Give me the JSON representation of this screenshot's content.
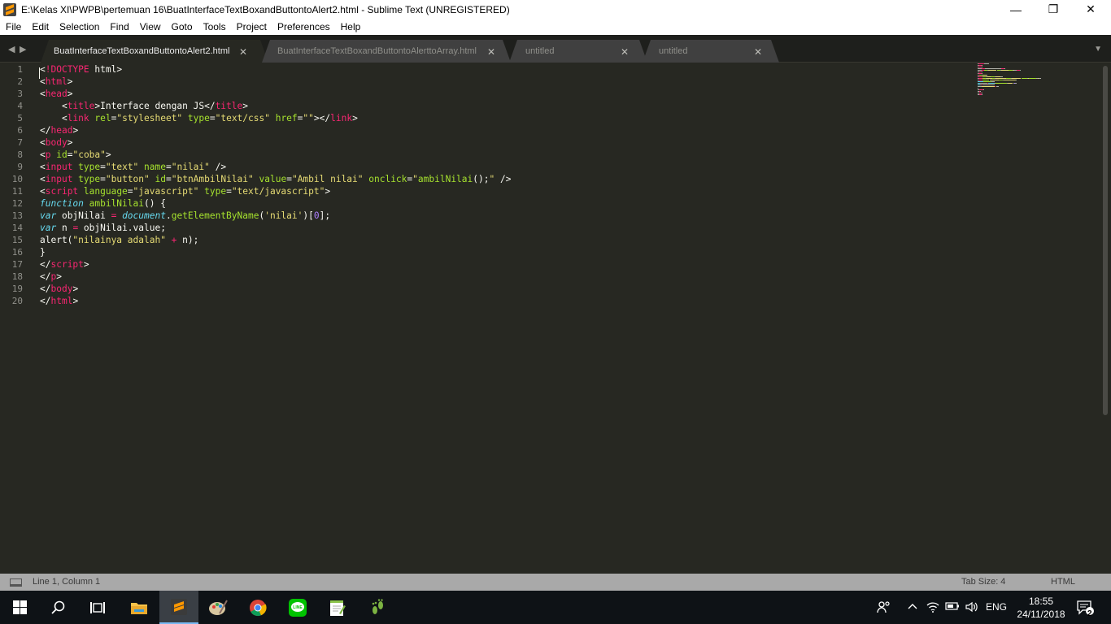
{
  "window": {
    "title": "E:\\Kelas XI\\PWPB\\pertemuan 16\\BuatInterfaceTextBoxandButtontoAlert2.html - Sublime Text (UNREGISTERED)",
    "controls": {
      "minimize": "—",
      "maximize": "❐",
      "close": "✕"
    }
  },
  "menu": [
    "File",
    "Edit",
    "Selection",
    "Find",
    "View",
    "Goto",
    "Tools",
    "Project",
    "Preferences",
    "Help"
  ],
  "tabs": [
    {
      "label": "BuatInterfaceTextBoxandButtontoAlert2.html",
      "active": true,
      "close": "✕"
    },
    {
      "label": "BuatInterfaceTextBoxandButtontoAlerttoArray.html",
      "active": false,
      "close": "✕"
    },
    {
      "label": "untitled",
      "active": false,
      "close": "✕"
    },
    {
      "label": "untitled",
      "active": false,
      "close": "✕"
    }
  ],
  "editor": {
    "line_numbers": [
      "1",
      "2",
      "3",
      "4",
      "5",
      "6",
      "7",
      "8",
      "9",
      "10",
      "11",
      "12",
      "13",
      "14",
      "15",
      "16",
      "17",
      "18",
      "19",
      "20"
    ],
    "code": [
      [
        [
          "p",
          "<"
        ],
        [
          "t",
          "!DOCTYPE"
        ],
        [
          "p",
          " html>"
        ]
      ],
      [
        [
          "p",
          "<"
        ],
        [
          "t",
          "html"
        ],
        [
          "p",
          ">"
        ]
      ],
      [
        [
          "p",
          "<"
        ],
        [
          "t",
          "head"
        ],
        [
          "p",
          ">"
        ]
      ],
      [
        [
          "p",
          "    <"
        ],
        [
          "t",
          "title"
        ],
        [
          "p",
          ">Interface dengan JS</"
        ],
        [
          "t",
          "title"
        ],
        [
          "p",
          ">"
        ]
      ],
      [
        [
          "p",
          "    <"
        ],
        [
          "t",
          "link"
        ],
        [
          "a",
          " rel"
        ],
        [
          "p",
          "="
        ],
        [
          "s",
          "\"stylesheet\""
        ],
        [
          "a",
          " type"
        ],
        [
          "p",
          "="
        ],
        [
          "s",
          "\"text/css\""
        ],
        [
          "a",
          " href"
        ],
        [
          "p",
          "="
        ],
        [
          "s",
          "\"\""
        ],
        [
          "p",
          "></"
        ],
        [
          "t",
          "link"
        ],
        [
          "p",
          ">"
        ]
      ],
      [
        [
          "p",
          "</"
        ],
        [
          "t",
          "head"
        ],
        [
          "p",
          ">"
        ]
      ],
      [
        [
          "p",
          "<"
        ],
        [
          "t",
          "body"
        ],
        [
          "p",
          ">"
        ]
      ],
      [
        [
          "p",
          "<"
        ],
        [
          "t",
          "p"
        ],
        [
          "a",
          " id"
        ],
        [
          "p",
          "="
        ],
        [
          "s",
          "\"coba\""
        ],
        [
          "p",
          ">"
        ]
      ],
      [
        [
          "p",
          "<"
        ],
        [
          "t",
          "input"
        ],
        [
          "a",
          " type"
        ],
        [
          "p",
          "="
        ],
        [
          "s",
          "\"text\""
        ],
        [
          "a",
          " name"
        ],
        [
          "p",
          "="
        ],
        [
          "s",
          "\"nilai\""
        ],
        [
          "p",
          " />"
        ]
      ],
      [
        [
          "p",
          "<"
        ],
        [
          "t",
          "input"
        ],
        [
          "a",
          " type"
        ],
        [
          "p",
          "="
        ],
        [
          "s",
          "\"button\""
        ],
        [
          "a",
          " id"
        ],
        [
          "p",
          "="
        ],
        [
          "s",
          "\"btnAmbilNilai\""
        ],
        [
          "a",
          " value"
        ],
        [
          "p",
          "="
        ],
        [
          "s",
          "\"Ambil nilai\""
        ],
        [
          "a",
          " onclick"
        ],
        [
          "p",
          "="
        ],
        [
          "s",
          "\""
        ],
        [
          "f",
          "ambilNilai"
        ],
        [
          "p",
          "();"
        ],
        [
          "s",
          "\""
        ],
        [
          "p",
          " />"
        ]
      ],
      [
        [
          "p",
          "<"
        ],
        [
          "t",
          "script"
        ],
        [
          "a",
          " language"
        ],
        [
          "p",
          "="
        ],
        [
          "s",
          "\"javascript\""
        ],
        [
          "a",
          " type"
        ],
        [
          "p",
          "="
        ],
        [
          "s",
          "\"text/javascript\""
        ],
        [
          "p",
          ">"
        ]
      ],
      [
        [
          "k",
          "function"
        ],
        [
          "f",
          " ambilNilai"
        ],
        [
          "p",
          "() {"
        ]
      ],
      [
        [
          "k",
          "var"
        ],
        [
          "p",
          " objNilai "
        ],
        [
          "o",
          "="
        ],
        [
          "k",
          " document"
        ],
        [
          "p",
          "."
        ],
        [
          "f",
          "getElementByName"
        ],
        [
          "p",
          "("
        ],
        [
          "s",
          "'nilai'"
        ],
        [
          "p",
          ")["
        ],
        [
          "n",
          "0"
        ],
        [
          "p",
          "];"
        ]
      ],
      [
        [
          "k",
          "var"
        ],
        [
          "p",
          " n "
        ],
        [
          "o",
          "="
        ],
        [
          "p",
          " objNilai.value;"
        ]
      ],
      [
        [
          "p",
          "alert("
        ],
        [
          "s",
          "\"nilainya adalah\""
        ],
        [
          "o",
          " +"
        ],
        [
          "p",
          " n);"
        ]
      ],
      [
        [
          "p",
          "}"
        ]
      ],
      [
        [
          "p",
          "</"
        ],
        [
          "t",
          "script"
        ],
        [
          "p",
          ">"
        ]
      ],
      [
        [
          "p",
          "</"
        ],
        [
          "t",
          "p"
        ],
        [
          "p",
          ">"
        ]
      ],
      [
        [
          "p",
          "</"
        ],
        [
          "t",
          "body"
        ],
        [
          "p",
          ">"
        ]
      ],
      [
        [
          "p",
          "</"
        ],
        [
          "t",
          "html"
        ],
        [
          "p",
          ">"
        ]
      ]
    ]
  },
  "status": {
    "position": "Line 1, Column 1",
    "tab_size": "Tab Size: 4",
    "syntax": "HTML"
  },
  "taskbar": {
    "apps": [
      "start-icon",
      "search-icon",
      "task-view-icon",
      "file-explorer-icon",
      "sublime-text-icon",
      "paint-icon",
      "chrome-icon",
      "line-icon",
      "notepad-plus-icon",
      "footprint-icon"
    ],
    "language": "ENG",
    "time": "18:55",
    "date": "24/11/2018",
    "notifications": "2"
  },
  "colors": {
    "editor_bg": "#272822",
    "tag": "#f92672",
    "attr": "#a6e22e",
    "string": "#e6db74",
    "keyword": "#66d9ef"
  }
}
